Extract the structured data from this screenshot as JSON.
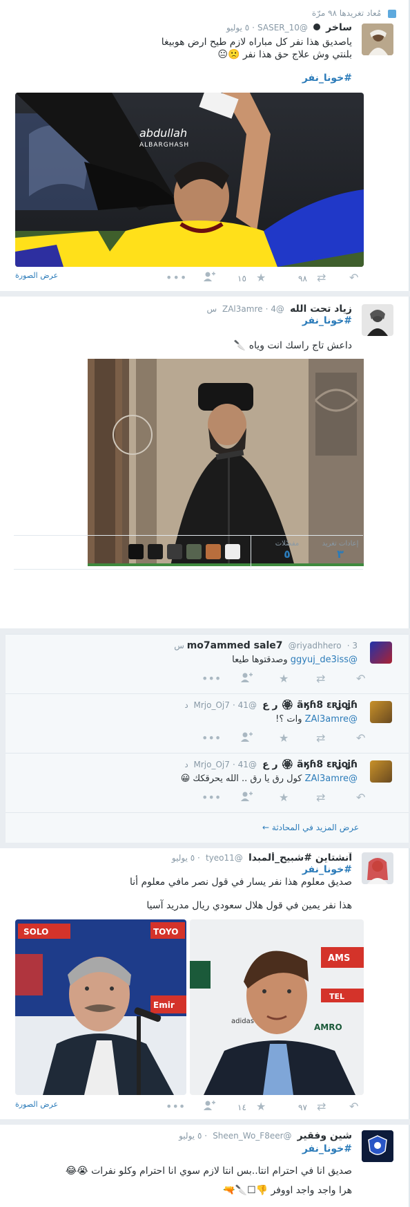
{
  "t1": {
    "retweet_note": "مُعاد تغريدها ٩٨ مرّة",
    "name": "ساخر",
    "handle": "@SASER_10",
    "time": "٥ يوليو",
    "text_line1": "ياصديق هذا نفر كل مباراه لازم طيح ارض هوبيغا",
    "text_line2": "بلنتي وش علاج حق هذا نفر  🙁😐",
    "hashtag": "#خونا_نفر",
    "watermark_line1": "abdullah",
    "watermark_line2": "ALBARGHASH",
    "view_photo": "عرض الصورة",
    "reply_count": "",
    "retweets": "٩٨",
    "favorites": "١٥"
  },
  "t2": {
    "name": "زياد تحت الله",
    "handle": "@ZAl3amre",
    "time": "4 س",
    "hashtag": "#خونا_نفر",
    "text": "داعش تاج راسك انت وياه 🔪",
    "stats_retweets_label": "إعادات تغريد",
    "stats_retweets_value": "٣",
    "stats_favorites_label": "مفضّلات",
    "stats_favorites_value": "٥"
  },
  "r1": {
    "name": "mo7ammed sale7",
    "handle": "@riyadhhero",
    "time": "3 س",
    "mention": "@ggyuj_de3iss",
    "text": "وصدقتوها طيعا"
  },
  "r2": {
    "name": "ǟӄɦ8 ɛʀʝօʝɦ 🏵 ﺭ ﻉ",
    "handle": "@Mrjo_Oj7",
    "time": "41 د",
    "mention": "@ZAl3amre",
    "text": "وات ؟!"
  },
  "r3": {
    "name": "ǟӄɦ8 ɛʀʝօʝɦ 🏵 ﺭ ﻉ",
    "handle": "@Mrjo_Oj7",
    "time": "41 د",
    "mention": "@ZAl3amre",
    "text": "كول رق يا رق .. الله يحرقكك 😀"
  },
  "more_conversation": "عرض المزيد في المحادثة ←",
  "t3": {
    "name": "آنشتاين #شبيح_ألمبدا",
    "handle": "@tyeo11",
    "time": "٥ يوليو",
    "hashtag": "#خونا_نفر",
    "text_line1": "صديق معلوم هذا نفر يسار في قول نصر مافي معلوم أنا",
    "text_line2": "هذا نفر يمين في قول هلال سعودي ريال مدريد آسيا",
    "view_photo": "عرض الصورة",
    "retweets": "٩٧",
    "favorites": "١٤",
    "sponsor_left": [
      "SOLO",
      "TOYO",
      "Emir"
    ],
    "sponsor_right": [
      "AMS",
      "TEL",
      "AMRO",
      "adidas"
    ]
  },
  "t4": {
    "name": "شين وفقير",
    "handle": "@Sheen_Wo_F8eer",
    "time": "٥ يوليو",
    "hashtag": "#خونا_نفر",
    "text_line1": "صديق انا في احترام انتا..بس انتا لازم سوي انا احترام وكلو نفرات 😭😂",
    "text_line2": "هرا واجد واجد اووفر 👎☐🔪🔫"
  },
  "icons": {
    "reply": "reply-icon",
    "retweet": "retweet-icon",
    "favorite": "star-icon",
    "more": "more-icon",
    "follow": "add-user-icon"
  },
  "colors": {
    "link": "#2b7bb9",
    "muted": "#8899a6",
    "icon": "#aab8c2"
  }
}
